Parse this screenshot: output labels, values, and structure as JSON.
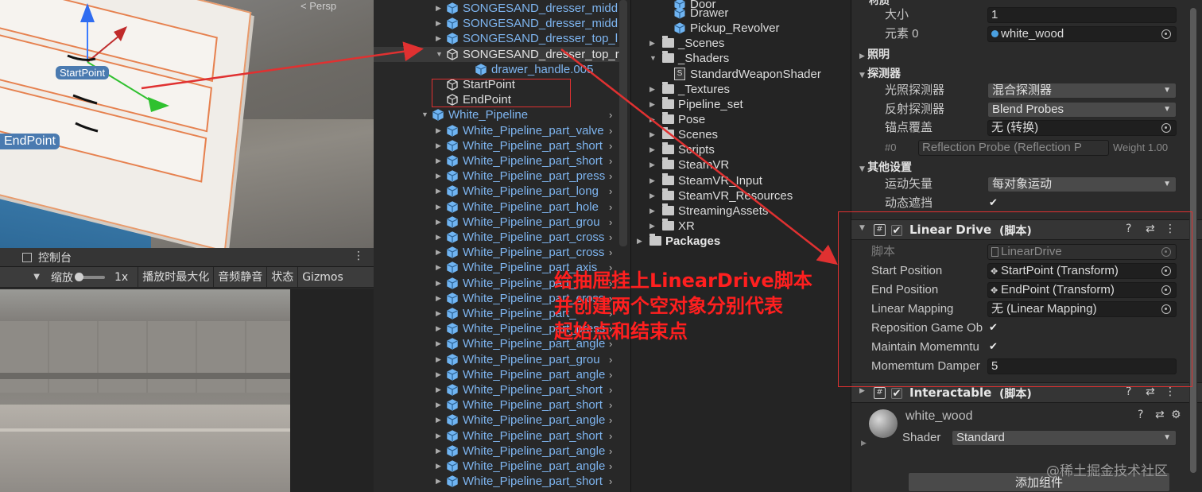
{
  "scene": {
    "persp_label": "< Persp",
    "labels": {
      "start": "StartPoint",
      "end": "EndPoint"
    }
  },
  "console": {
    "title": "控制台",
    "toolbar": {
      "zoom_label": "缩放",
      "zoom_value": "1x",
      "maximize": "播放时最大化",
      "mute": "音频静音",
      "stats": "状态",
      "gizmos": "Gizmos"
    }
  },
  "hierarchy": {
    "rows": [
      {
        "text": "SONGESAND_dresser_midd",
        "color": "blue"
      },
      {
        "text": "SONGESAND_dresser_midd",
        "color": "blue"
      },
      {
        "text": "SONGESAND_dresser_top_l",
        "color": "blue"
      },
      {
        "text": "SONGESAND_dresser_top_r",
        "color": "white"
      },
      {
        "text": "drawer_handle.005",
        "color": "blue"
      },
      {
        "text": "StartPoint",
        "color": "white"
      },
      {
        "text": "EndPoint",
        "color": "white"
      },
      {
        "text": "White_Pipeline",
        "color": "blue"
      },
      {
        "text": "White_Pipeline_part_valve",
        "color": "blue"
      },
      {
        "text": "White_Pipeline_part_short",
        "color": "blue"
      },
      {
        "text": "White_Pipeline_part_short",
        "color": "blue"
      },
      {
        "text": "White_Pipeline_part_press",
        "color": "blue"
      },
      {
        "text": "White_Pipeline_part_long",
        "color": "blue"
      },
      {
        "text": "White_Pipeline_part_hole",
        "color": "blue"
      },
      {
        "text": "White_Pipeline_part_grou",
        "color": "blue"
      },
      {
        "text": "White_Pipeline_part_cross",
        "color": "blue"
      },
      {
        "text": "White_Pipeline_part_cross",
        "color": "blue"
      },
      {
        "text": "White_Pipeline_part_axis",
        "color": "blue"
      },
      {
        "text": "White_Pipeline_part_",
        "color": "blue"
      },
      {
        "text": "White_Pipeline_part_cross",
        "color": "blue"
      },
      {
        "text": "White_Pipeline_part_",
        "color": "blue"
      },
      {
        "text": "White_Pipeline_part_press",
        "color": "blue"
      },
      {
        "text": "White_Pipeline_part_angle",
        "color": "blue"
      },
      {
        "text": "White_Pipeline_part_grou",
        "color": "blue"
      },
      {
        "text": "White_Pipeline_part_angle",
        "color": "blue"
      },
      {
        "text": "White_Pipeline_part_short",
        "color": "blue"
      },
      {
        "text": "White_Pipeline_part_short",
        "color": "blue"
      },
      {
        "text": "White_Pipeline_part_angle",
        "color": "blue"
      },
      {
        "text": "White_Pipeline_part_short",
        "color": "blue"
      },
      {
        "text": "White_Pipeline_part_angle",
        "color": "blue"
      },
      {
        "text": "White_Pipeline_part_angle",
        "color": "blue"
      },
      {
        "text": "White_Pipeline_part_short",
        "color": "blue"
      }
    ]
  },
  "project": {
    "items": [
      "Door",
      "Drawer",
      "Pickup_Revolver",
      "_Scenes",
      "_Shaders",
      "StandardWeaponShader",
      "_Textures",
      "Pipeline_set",
      "Pose",
      "Scenes",
      "Scripts",
      "SteamVR",
      "SteamVR_Input",
      "SteamVR_Resources",
      "StreamingAssets",
      "XR",
      "Packages"
    ]
  },
  "inspector": {
    "top_label": "材质",
    "size_label": "大小",
    "size_value": "1",
    "element0_label": "元素 0",
    "element0_value": "white_wood",
    "lighting": "照明",
    "probes": "探测器",
    "light_probes_label": "光照探测器",
    "light_probes_value": "混合探测器",
    "reflection_probes_label": "反射探测器",
    "reflection_probes_value": "Blend Probes",
    "anchor_label": "锚点覆盖",
    "anchor_value": "无 (转换)",
    "probe_index": "#0",
    "probe_ref": "Reflection Probe (Reflection P",
    "probe_weight": "Weight 1.00",
    "other_settings": "其他设置",
    "motion_vectors_label": "运动矢量",
    "motion_vectors_value": "每对象运动",
    "dynamic_occlusion_label": "动态遮挡",
    "linear_drive": {
      "title": "Linear Drive",
      "suffix": "(脚本)",
      "script_label": "脚本",
      "script_value": "LinearDrive",
      "start_label": "Start Position",
      "start_value": "StartPoint (Transform)",
      "end_label": "End Position",
      "end_value": "EndPoint (Transform)",
      "mapping_label": "Linear Mapping",
      "mapping_value": "无 (Linear Mapping)",
      "reposition_label": "Reposition Game Ob",
      "maintain_label": "Maintain Momemntu",
      "damper_label": "Momemtum Damper",
      "damper_value": "5"
    },
    "interactable": {
      "title": "Interactable",
      "suffix": "(脚本)"
    },
    "material": {
      "name": "white_wood",
      "shader_label": "Shader",
      "shader_value": "Standard"
    },
    "add_component": "添加组件"
  },
  "annotation": {
    "lines": [
      "给抽屉挂上LinearDrive脚本",
      "并创建两个空对象分别代表",
      "起始点和结束点"
    ]
  },
  "watermark": "@稀土掘金技术社区",
  "colors": {
    "accent_red": "#ff1f1f",
    "hierarchy_blue": "#7eb5f0",
    "scene_label_bg": "#4a7ab0"
  }
}
